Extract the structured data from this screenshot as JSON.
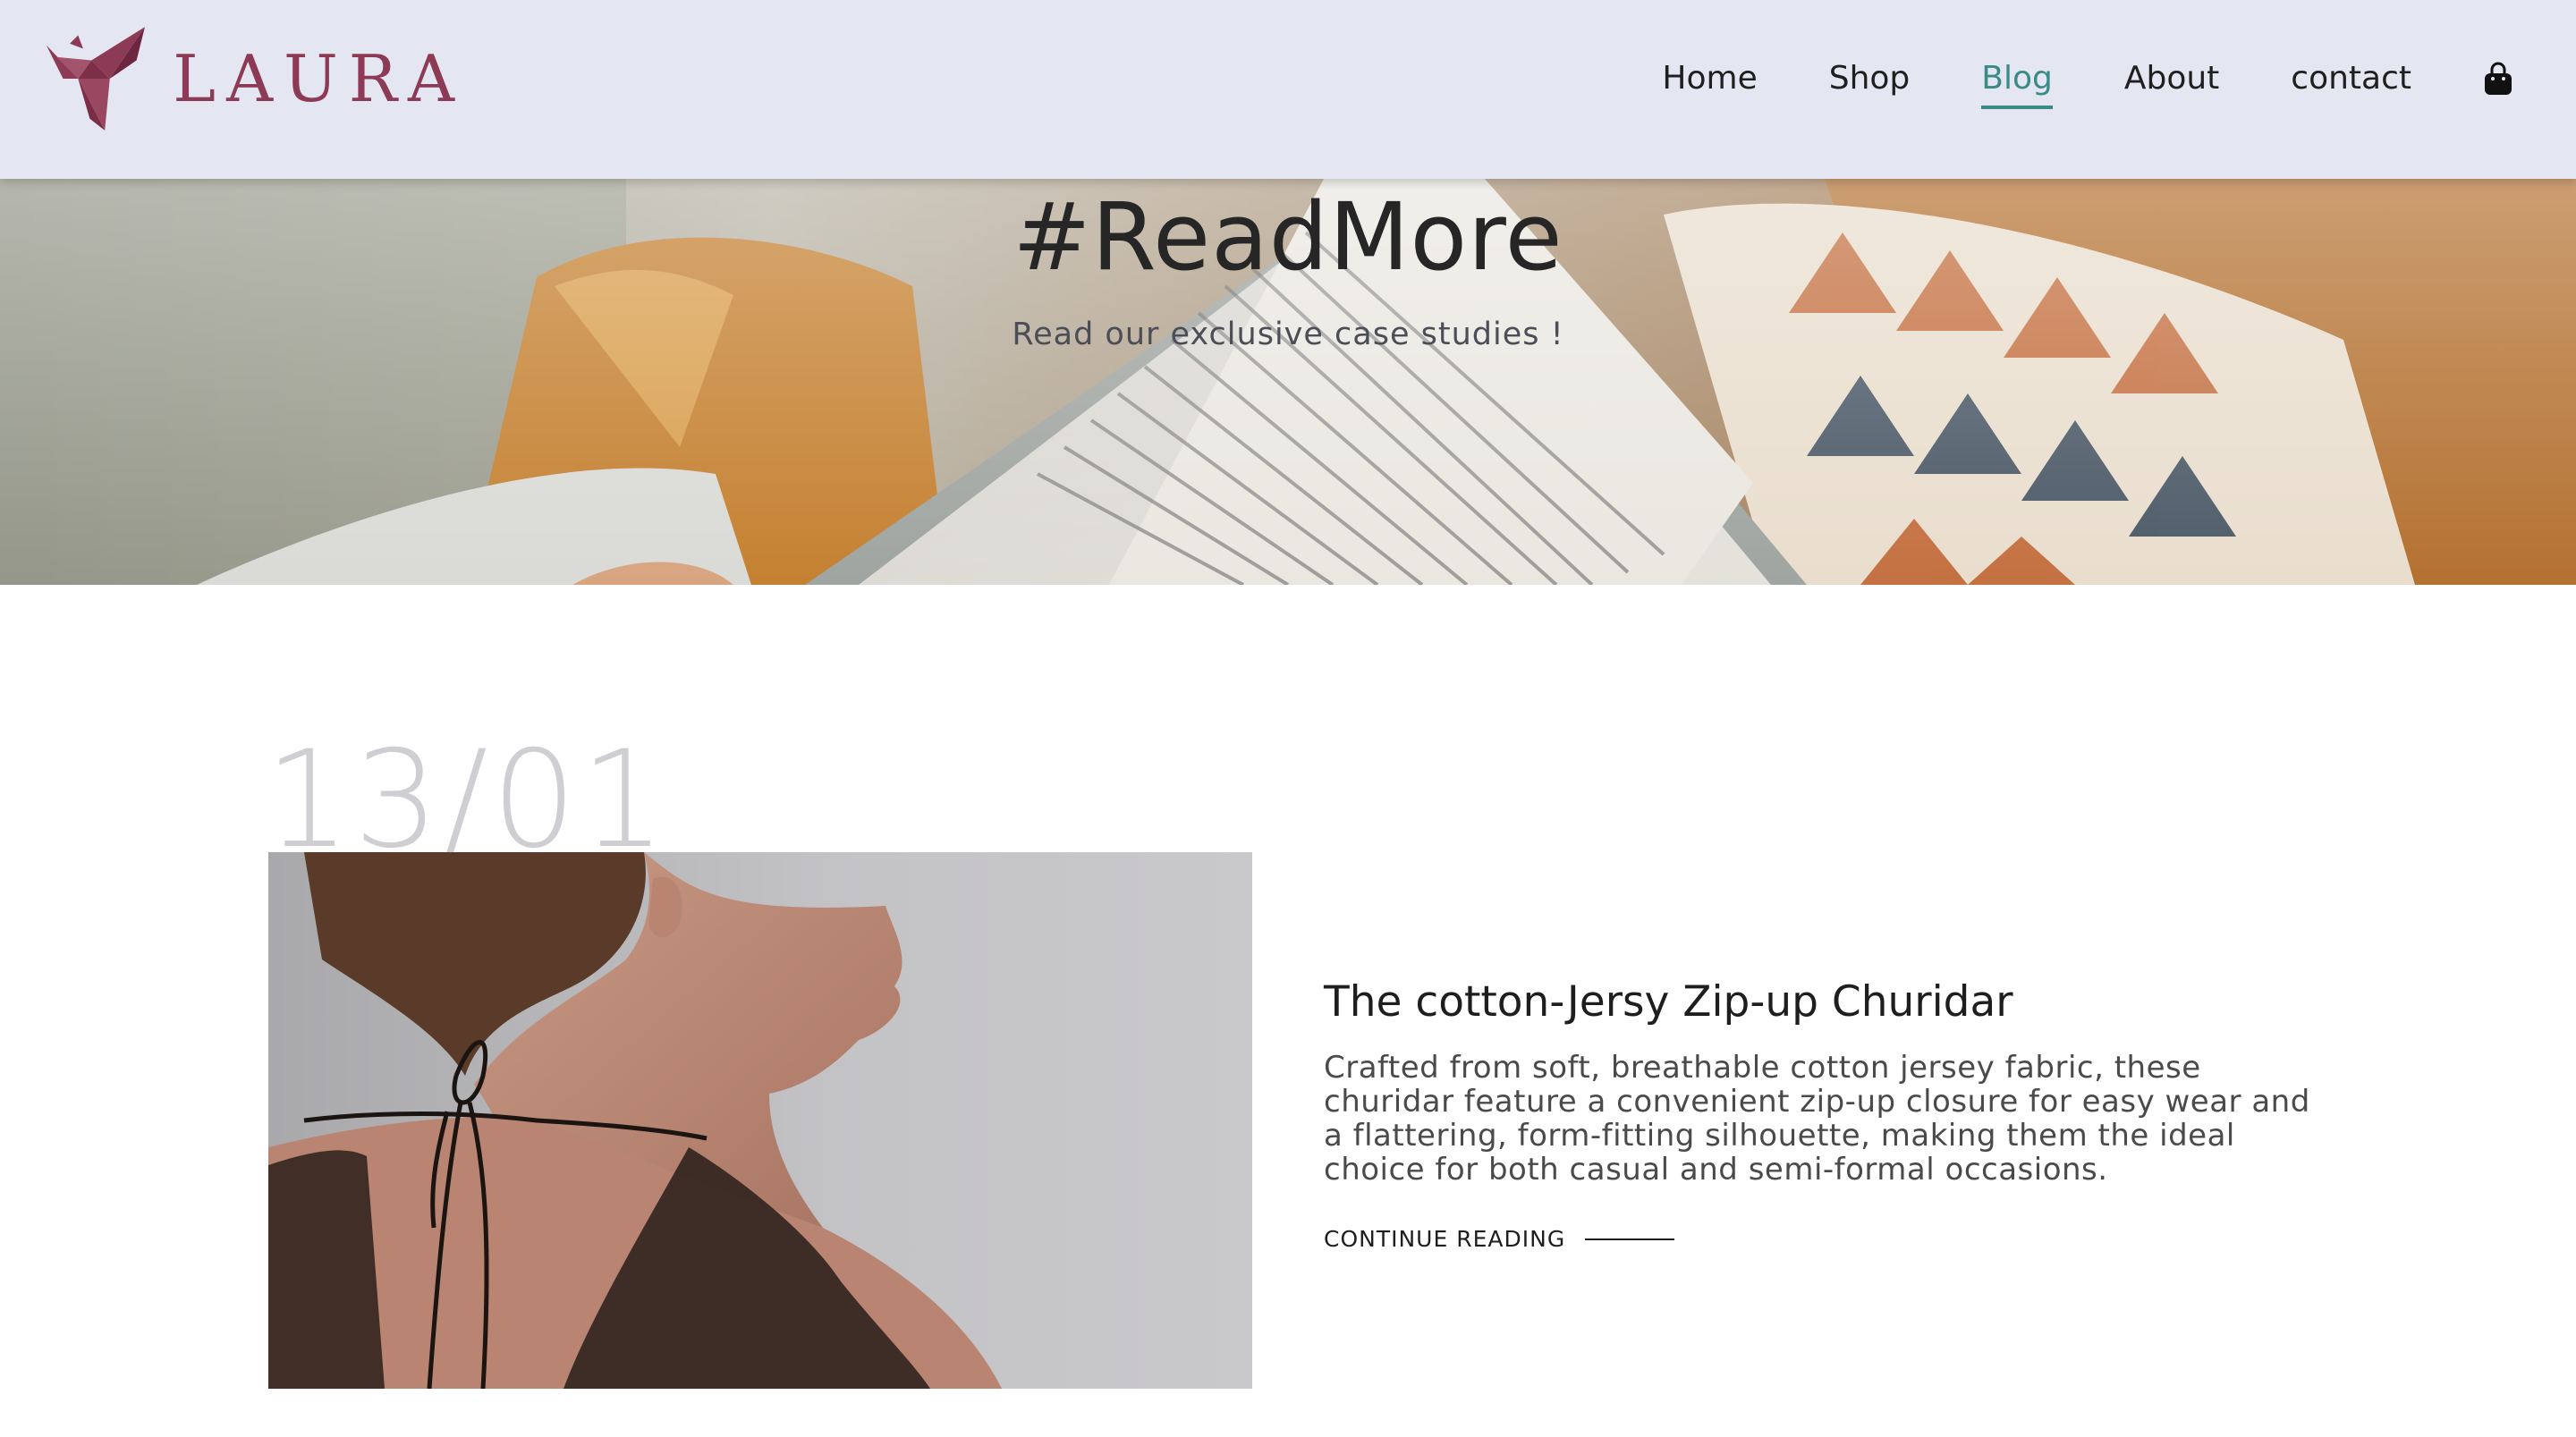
{
  "brand": {
    "name": "LAURA",
    "color": "#8c3a55"
  },
  "nav": {
    "items": [
      {
        "label": "Home",
        "active": false
      },
      {
        "label": "Shop",
        "active": false
      },
      {
        "label": "Blog",
        "active": true
      },
      {
        "label": "About",
        "active": false
      },
      {
        "label": "contact",
        "active": false
      }
    ],
    "cart_icon": "shopping-bag-icon",
    "accent_color": "#3a8a86"
  },
  "hero": {
    "title": "#ReadMore",
    "subtitle": "Read our exclusive case studies !"
  },
  "post": {
    "date": "13/01",
    "title": "The cotton-Jersy Zip-up Churidar",
    "excerpt": "Crafted from soft, breathable cotton jersey fabric, these churidar feature a convenient zip-up closure for easy wear and a flattering, form-fitting silhouette, making them the ideal choice for both casual and semi-formal occasions.",
    "cta": "CONTINUE READING"
  }
}
